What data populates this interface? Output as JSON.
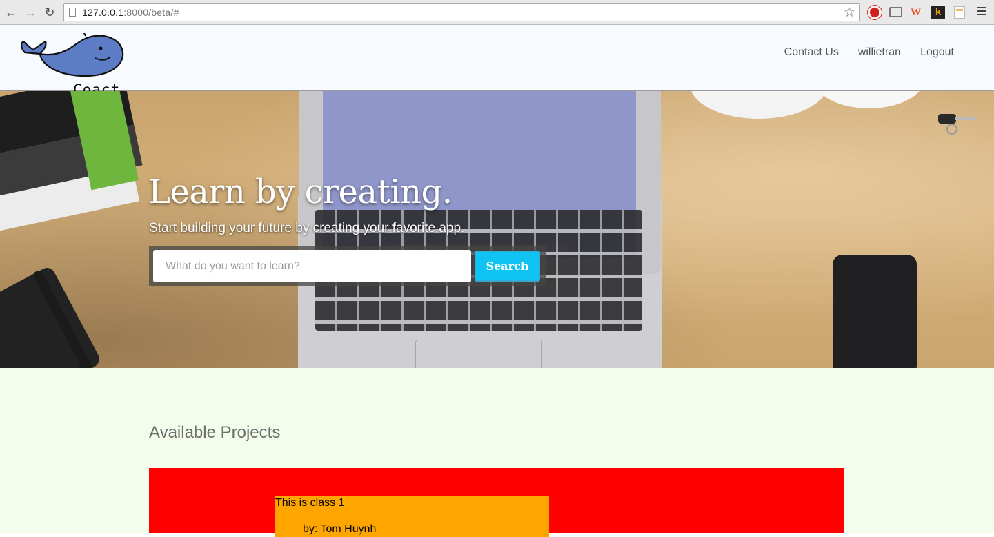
{
  "browser": {
    "url_host": "127.0.0.1",
    "url_rest": ":8000/beta/#"
  },
  "header": {
    "logo_text": "Coact",
    "nav": [
      "Contact Us",
      "willietran",
      "Logout"
    ]
  },
  "hero": {
    "title": "Learn by creating.",
    "subtitle": "Start building your future by creating your favorite app.",
    "search_placeholder": "What do you want to learn?",
    "search_button": "Search"
  },
  "projects": {
    "heading": "Available Projects",
    "items": [
      {
        "name": "This is class 1",
        "author": "by: Tom Huynh"
      }
    ]
  },
  "colors": {
    "accent": "#0fc3f3",
    "projects_bg": "#ff0000",
    "card_bg": "#ffa500",
    "section_bg": "#f3fdeb"
  }
}
